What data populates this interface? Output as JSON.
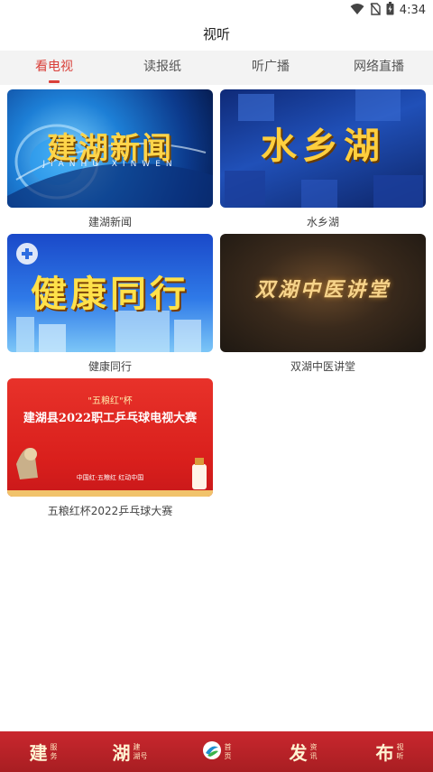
{
  "status_bar": {
    "time": "4:34",
    "icons": [
      "wifi-icon",
      "no-sim-icon",
      "battery-icon"
    ]
  },
  "header": {
    "title": "视听"
  },
  "tabs": [
    {
      "label": "看电视",
      "active": true
    },
    {
      "label": "读报纸",
      "active": false
    },
    {
      "label": "听广播",
      "active": false
    },
    {
      "label": "网络直播",
      "active": false
    }
  ],
  "items": [
    {
      "caption": "建湖新闻",
      "thumb_title": "建湖新闻",
      "thumb_sub": "JIANHU XINWEN"
    },
    {
      "caption": "水乡湖",
      "thumb_title": "水乡湖"
    },
    {
      "caption": "健康同行",
      "thumb_title": "健康同行"
    },
    {
      "caption": "双湖中医讲堂",
      "thumb_title": "双湖中医讲堂"
    },
    {
      "caption": "五粮红杯2022乒乓球大赛",
      "thumb_title": "建湖县2022职工乒乓球电视大赛",
      "thumb_top": "\"五粮红\"杯",
      "thumb_slogan": "中国红·五粮红 红动中国"
    }
  ],
  "bottom_nav": [
    {
      "big": "建",
      "small1": "服",
      "small2": "务"
    },
    {
      "big": "湖",
      "small1": "建",
      "small2": "湖号"
    },
    {
      "big": "",
      "small1": "首",
      "small2": "页"
    },
    {
      "big": "发",
      "small1": "资",
      "small2": "讯"
    },
    {
      "big": "布",
      "small1": "视",
      "small2": "听"
    }
  ],
  "colors": {
    "accent": "#d9403a",
    "nav_bg": "#b72228"
  }
}
